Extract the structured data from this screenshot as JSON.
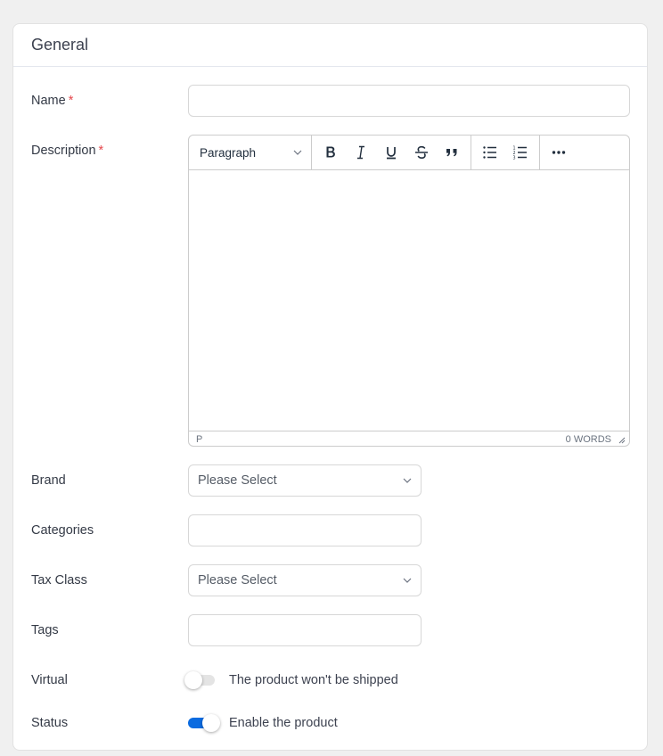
{
  "card": {
    "title": "General"
  },
  "fields": {
    "name": {
      "label": "Name",
      "required_mark": "*",
      "value": "",
      "placeholder": ""
    },
    "description": {
      "label": "Description",
      "required_mark": "*",
      "editor": {
        "block_format": "Paragraph",
        "toolbar": {
          "bold": "bold-icon",
          "italic": "italic-icon",
          "underline": "underline-icon",
          "strikethrough": "strikethrough-icon",
          "blockquote": "blockquote-icon",
          "bullet_list": "bullet-list-icon",
          "numbered_list": "numbered-list-icon",
          "more": "more-icon"
        },
        "content": "",
        "path": "P",
        "word_count": "0 WORDS"
      }
    },
    "brand": {
      "label": "Brand",
      "selected": "Please Select"
    },
    "categories": {
      "label": "Categories",
      "value": ""
    },
    "tax_class": {
      "label": "Tax Class",
      "selected": "Please Select"
    },
    "tags": {
      "label": "Tags",
      "value": ""
    },
    "virtual": {
      "label": "Virtual",
      "checked": false,
      "description": "The product won't be shipped"
    },
    "status": {
      "label": "Status",
      "checked": true,
      "description": "Enable the product"
    }
  },
  "colors": {
    "accent": "#0b6be0",
    "required": "#e5484d",
    "background": "#f0f0f0"
  }
}
